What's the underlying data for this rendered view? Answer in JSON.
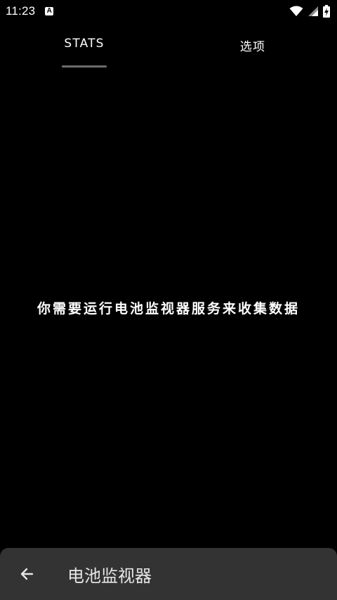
{
  "status_bar": {
    "time": "11:23",
    "notification_icon": "a-icon",
    "wifi_icon": "wifi-icon",
    "signal_icon": "signal-icon",
    "battery_icon": "battery-charging-icon"
  },
  "tabs": [
    {
      "label": "STATS",
      "selected": true
    },
    {
      "label": "选项",
      "selected": false
    }
  ],
  "main": {
    "empty_message": "你需要运行电池监视器服务来收集数据"
  },
  "bottom_bar": {
    "back_icon": "arrow-left-icon",
    "title": "电池监视器"
  },
  "colors": {
    "background": "#000000",
    "text": "#ffffff",
    "tab_indicator": "#6b6b6b",
    "bottom_bar": "#333333"
  }
}
